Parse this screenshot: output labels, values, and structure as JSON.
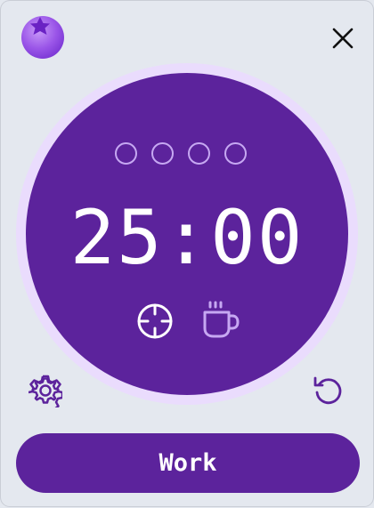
{
  "app": {
    "logo_icon": "grape-logo-icon"
  },
  "window": {
    "close_icon": "close-icon"
  },
  "timer": {
    "display": "25:00",
    "sessions_total": 4,
    "sessions_completed": 0,
    "modes": [
      {
        "icon": "focus-crosshair-icon",
        "active": true
      },
      {
        "icon": "coffee-break-icon",
        "active": false
      }
    ]
  },
  "controls": {
    "settings_icon": "gear-icon",
    "reset_icon": "reset-icon",
    "primary_button_label": "Work"
  },
  "colors": {
    "background": "#e4e8ef",
    "dial": "#5c239c",
    "dial_ring": "#eadcfd",
    "accent_light": "#c6a8f2",
    "icon": "#5c239c",
    "text_on_dial": "#ffffff"
  }
}
